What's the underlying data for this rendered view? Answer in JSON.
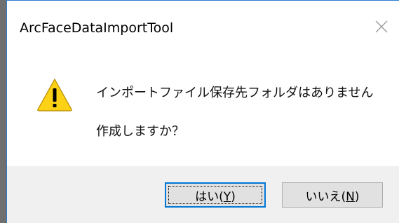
{
  "dialog": {
    "title": "ArcFaceDataImportTool",
    "close_icon": "close-icon",
    "icon": "warning-icon",
    "message_line1": "インポートファイル保存先フォルダはありません",
    "message_line2": "作成しますか？",
    "buttons": {
      "yes": {
        "label_main": "はい(",
        "mnemonic": "Y",
        "label_end": ")"
      },
      "no": {
        "label_main": "いいえ(",
        "mnemonic": "N",
        "label_end": ")"
      }
    }
  },
  "colors": {
    "accent": "#0078d7",
    "warning_fill": "#fcd116",
    "footer_bg": "#f0f0f0"
  }
}
